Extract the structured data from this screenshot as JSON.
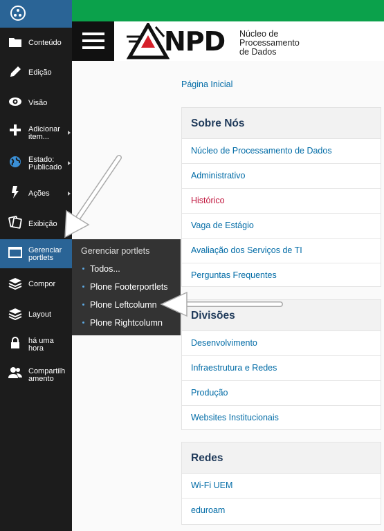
{
  "toolbar": {
    "items": [
      {
        "label": "Conteúdo",
        "icon": "folder-icon"
      },
      {
        "label": "Edição",
        "icon": "pencil-icon"
      },
      {
        "label": "Visão",
        "icon": "eye-icon"
      },
      {
        "label": "Adicionar item...",
        "icon": "plus-icon"
      },
      {
        "label": "Estado: Publicado",
        "icon": "globe-icon"
      },
      {
        "label": "Ações",
        "icon": "bolt-icon"
      },
      {
        "label": "Exibição",
        "icon": "display-icon"
      },
      {
        "label": "Gerenciar portlets",
        "icon": "portlets-icon"
      },
      {
        "label": "Compor",
        "icon": "layers-icon"
      },
      {
        "label": "Layout",
        "icon": "layers-icon"
      },
      {
        "label": "há uma hora",
        "icon": "lock-icon"
      },
      {
        "label": "Compartilhamento",
        "icon": "users-icon"
      }
    ]
  },
  "header": {
    "logo_text": "NPD",
    "logo_subtitle": [
      "Núcleo de",
      "Processamento",
      "de Dados"
    ]
  },
  "breadcrumb": "Página Inicial",
  "submenu": {
    "title": "Gerenciar portlets",
    "options": [
      "Todos...",
      "Plone Footerportlets",
      "Plone Leftcolumn",
      "Plone Rightcolumn"
    ]
  },
  "portlets": {
    "sobre": {
      "title": "Sobre Nós",
      "items": [
        "Núcleo de Processamento de Dados",
        "Administrativo",
        "Histórico",
        "Vaga de Estágio",
        "Avaliação dos Serviços de TI",
        "Perguntas Frequentes"
      ]
    },
    "divisoes": {
      "title": "Divisões",
      "items": [
        "Desenvolvimento",
        "Infraestrutura e Redes",
        "Produção",
        "Websites Institucionais"
      ]
    },
    "redes": {
      "title": "Redes",
      "items": [
        "Wi-Fi UEM",
        "eduroam"
      ]
    }
  },
  "colors": {
    "toolbar_bg": "#1c1c1c",
    "toolbar_active": "#2a6496",
    "topbar_green": "#0ba14b",
    "link": "#006ba6",
    "visited_link": "#c0143c",
    "logo_red": "#d6202a"
  }
}
